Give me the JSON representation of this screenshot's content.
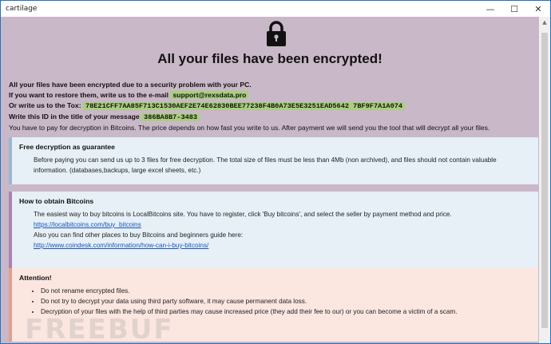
{
  "window": {
    "title": "cartilage",
    "minimize": "—",
    "maximize": "☐",
    "close": "✕"
  },
  "header": {
    "lock_icon": "padlock-icon",
    "title": "All your files have been encrypted!"
  },
  "info": {
    "line1": "All your files have been encrypted due to a security problem with your PC.",
    "line2_prefix": "If you want to restore them, write us to the e-mail",
    "email": "support@rexsdata.pro",
    "line3_prefix": "Or write us to the Tox:",
    "tox_id": "78E21CFF7AA85F713C1530AEF2E74E62830BEE77238F4B0A73E5E3251EAD5642 7BF9F7A1A074",
    "line4_prefix": "Write this ID in the title of your message",
    "message_id": "386BA8B7-3483",
    "line5": "You have to pay for decryption in Bitcoins. The price depends on how fast you write to us. After payment we will send you the tool that will decrypt all your files."
  },
  "free_decryption": {
    "heading": "Free decryption as guarantee",
    "text": "Before paying you can send us up to 3 files for free decryption. The total size of files must be less than 4Mb (non archived), and files should not contain valuable information. (databases,backups, large excel sheets, etc.)"
  },
  "bitcoins": {
    "heading": "How to obtain Bitcoins",
    "text1": "The easiest way to buy bitcoins is LocalBitcoins site. You have to register, click 'Buy bitcoins', and select the seller by payment method and price.",
    "link1": "https://localbitcoins.com/buy_bitcoins",
    "text2": "Also you can find other places to buy Bitcoins and beginners guide here:",
    "link2": "http://www.coindesk.com/information/how-can-i-buy-bitcoins/"
  },
  "attention": {
    "heading": "Attention!",
    "items": [
      "Do not rename encrypted files.",
      "Do not try to decrypt your data using third party software, it may cause permanent data loss.",
      "Decryption of your files with the help of third parties may cause increased price (they add their fee to our) or you can become a victim of a scam."
    ]
  },
  "watermark": "FREEBUF"
}
